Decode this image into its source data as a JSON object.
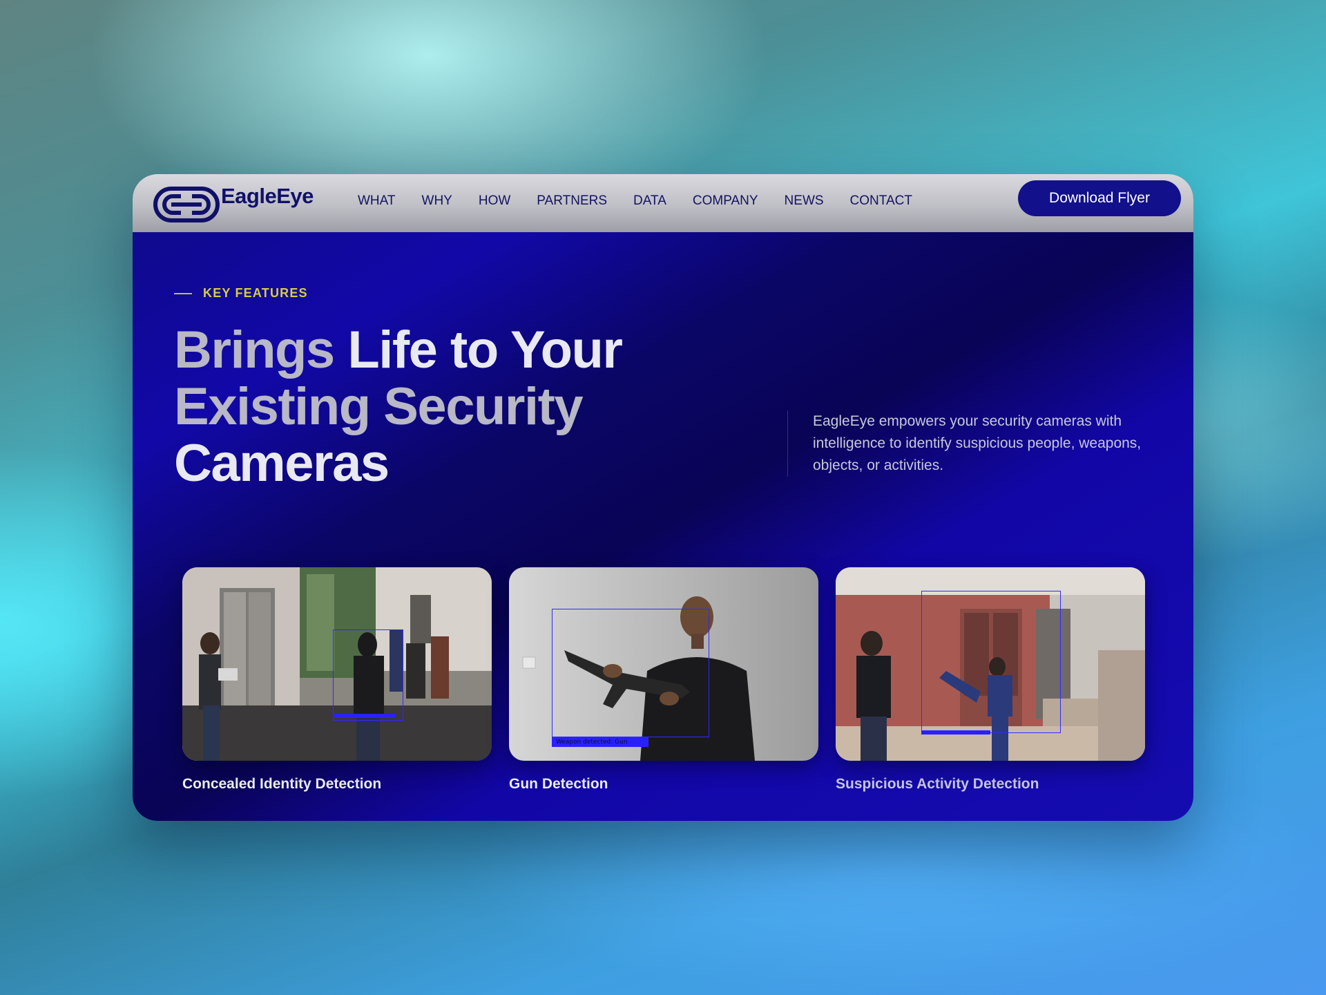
{
  "brand": {
    "name": "EagleEye",
    "logo_icon": "eagleeye-logo-icon"
  },
  "nav": {
    "items": [
      {
        "label": "WHAT"
      },
      {
        "label": "WHY"
      },
      {
        "label": "HOW"
      },
      {
        "label": "PARTNERS"
      },
      {
        "label": "DATA"
      },
      {
        "label": "COMPANY"
      },
      {
        "label": "NEWS"
      },
      {
        "label": "CONTACT"
      }
    ],
    "cta_label": "Download Flyer"
  },
  "hero": {
    "kicker": "KEY FEATURES",
    "headline": {
      "line1_a": "Brings ",
      "line1_b": "Life to Your",
      "line2_a": "Existing ",
      "line2_b": "Security",
      "line3": "Cameras"
    },
    "description": "EagleEye empowers your security cameras with intelligence to identify suspicious people, weapons, objects, or activities."
  },
  "features": [
    {
      "title": "Concealed Identity Detection"
    },
    {
      "title": "Gun Detection",
      "overlay_label": "Weapon detected: Gun"
    },
    {
      "title": "Suspicious Activity Detection"
    }
  ],
  "colors": {
    "brand_navy": "#12108a",
    "accent_yellow": "#d6ce3e",
    "hero_blue": "#1208a8",
    "detection_box": "#2a20ff"
  }
}
